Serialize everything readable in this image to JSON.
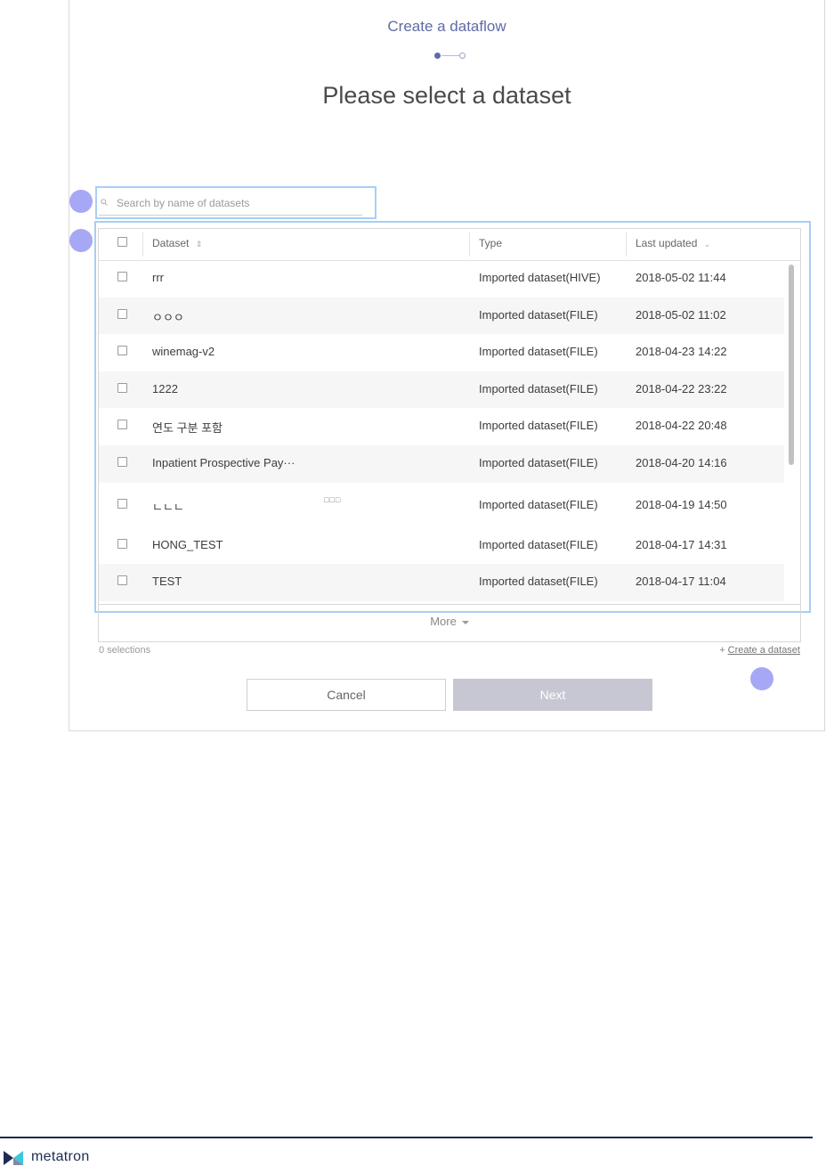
{
  "dialog": {
    "step_title": "Create a dataflow",
    "heading": "Please select a dataset"
  },
  "search": {
    "placeholder": "Search by name of datasets",
    "value": ""
  },
  "table": {
    "headers": {
      "dataset": "Dataset",
      "type": "Type",
      "last_updated": "Last updated"
    },
    "rows": [
      {
        "name": "rrr",
        "extra": "",
        "type": "Imported dataset(HIVE)",
        "date": "2018-05-02 11:44"
      },
      {
        "name": "ㅇㅇㅇ",
        "extra": "",
        "type": "Imported dataset(FILE)",
        "date": "2018-05-02 11:02"
      },
      {
        "name": "winemag-v2",
        "extra": "",
        "type": "Imported dataset(FILE)",
        "date": "2018-04-23 14:22"
      },
      {
        "name": "1222",
        "extra": "",
        "type": "Imported dataset(FILE)",
        "date": "2018-04-22 23:22"
      },
      {
        "name": "연도 구분 포함",
        "extra": "",
        "type": "Imported dataset(FILE)",
        "date": "2018-04-22 20:48"
      },
      {
        "name": "Inpatient Prospective Pay···",
        "extra": "",
        "type": "Imported dataset(FILE)",
        "date": "2018-04-20 14:16"
      },
      {
        "name": "ㄴㄴㄴ",
        "extra": "□□□",
        "type": "Imported dataset(FILE)",
        "date": "2018-04-19 14:50"
      },
      {
        "name": "HONG_TEST",
        "extra": "",
        "type": "Imported dataset(FILE)",
        "date": "2018-04-17 14:31"
      },
      {
        "name": "TEST",
        "extra": "",
        "type": "Imported dataset(FILE)",
        "date": "2018-04-17 11:04"
      }
    ]
  },
  "more_label": "More",
  "selections_label": "0 selections",
  "create_dataset": {
    "plus": "+",
    "label": "Create a dataset"
  },
  "buttons": {
    "cancel": "Cancel",
    "next": "Next"
  },
  "footer": {
    "brand": "metatron"
  },
  "colors": {
    "accent": "#5f6ba8",
    "highlight": "#a9cef5",
    "marker": "#a7a8f5",
    "next_disabled": "#c6c7d2",
    "footer": "#1e2a52"
  },
  "icons": {
    "search": "search-icon",
    "sort": "sort-icon",
    "caret": "caret-down-icon",
    "logo": "metatron-logo-icon"
  }
}
